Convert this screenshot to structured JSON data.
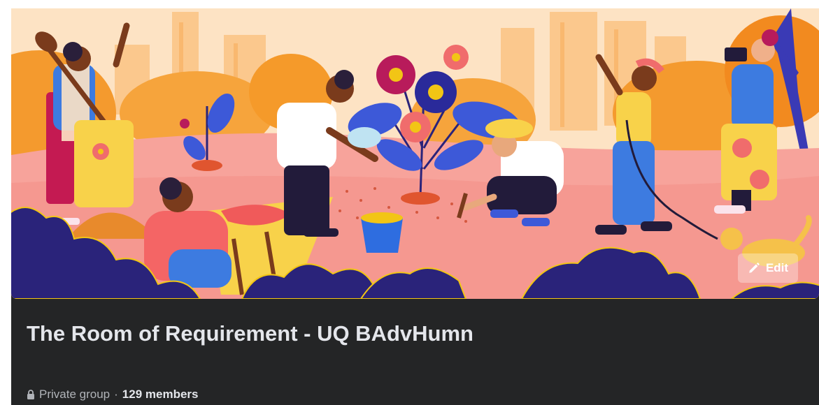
{
  "cover": {
    "edit_label": "Edit",
    "edit_icon": "pencil-icon"
  },
  "group": {
    "title": "The Room of Requirement - UQ BAdvHumn",
    "privacy": "Private group",
    "separator": "·",
    "members": "129 members",
    "privacy_icon": "lock-icon"
  },
  "colors": {
    "card_bg": "#242526",
    "title": "#e4e6eb",
    "secondary_text": "#b0b3b8",
    "sky": "#fde3c4",
    "ground": "#f7a39b",
    "bush": "#2a237a"
  }
}
